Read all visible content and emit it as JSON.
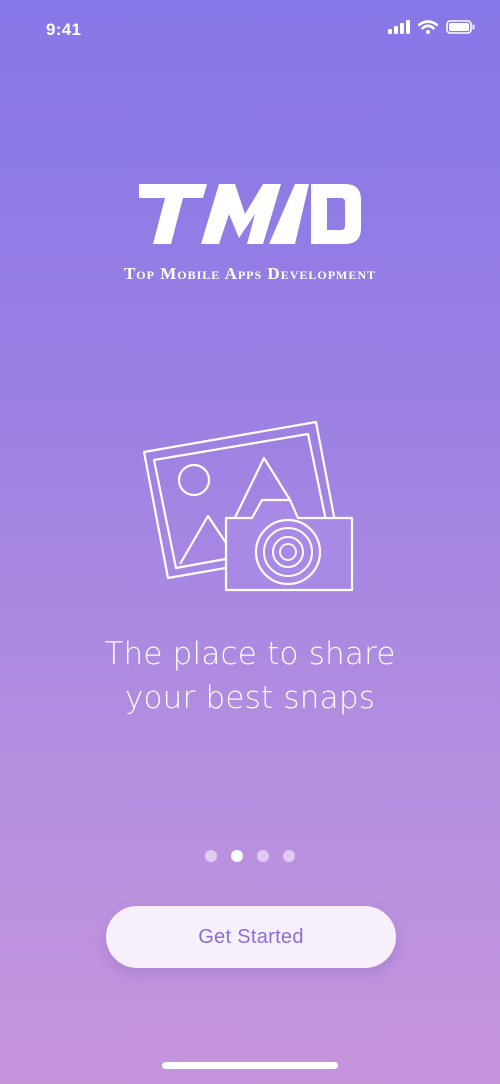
{
  "status_bar": {
    "time": "9:41",
    "icons": [
      "cellular-signal-icon",
      "wifi-icon",
      "battery-icon"
    ]
  },
  "logo": {
    "wordmark": "TMD",
    "subtitle": "Top Mobile Apps Development"
  },
  "illustration": {
    "icons": [
      "photo-frame-icon",
      "camera-icon"
    ]
  },
  "onboarding": {
    "tagline_line1": "The place to share",
    "tagline_line2": "your best snaps",
    "page_count": 4,
    "active_page": 2
  },
  "cta": {
    "label": "Get Started"
  },
  "colors": {
    "gradient_top": "#8677e8",
    "gradient_bottom": "#c595dc",
    "button_bg": "#f7f0fb",
    "button_text": "#8a6dd9",
    "foreground": "#ffffff"
  }
}
